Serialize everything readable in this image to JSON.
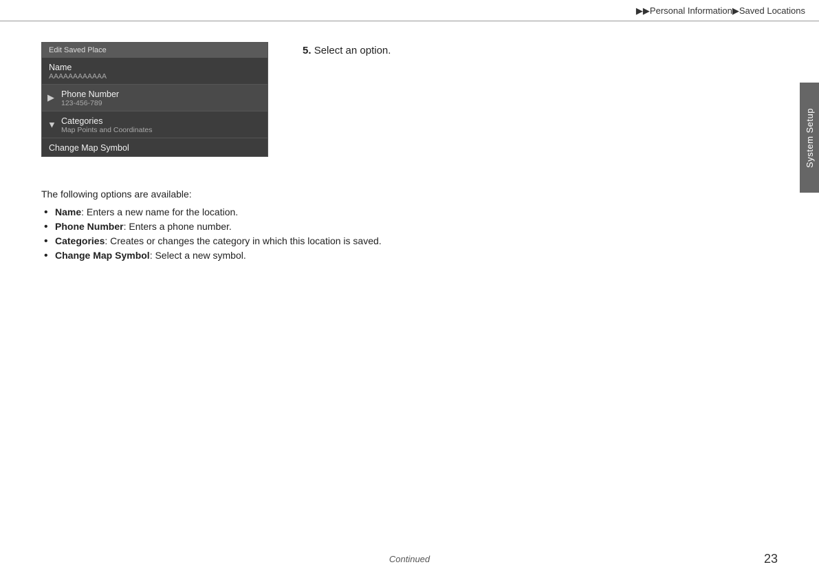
{
  "header": {
    "breadcrumb_arrow1": "▶▶",
    "breadcrumb_part1": "Personal Information",
    "breadcrumb_arrow2": "▶",
    "breadcrumb_part2": "Saved Locations"
  },
  "sidebar": {
    "label": "System Setup"
  },
  "screen": {
    "title": "Edit Saved Place",
    "items": [
      {
        "label": "Name",
        "sub": "AAAAAAAAAAAA",
        "has_left_arrow": false,
        "has_down_arrow": false
      },
      {
        "label": "Phone Number",
        "sub": "123-456-789",
        "has_left_arrow": true,
        "has_down_arrow": false
      },
      {
        "label": "Categories",
        "sub": "Map Points and Coordinates",
        "has_left_arrow": false,
        "has_down_arrow": true
      },
      {
        "label": "Change Map Symbol",
        "sub": "",
        "has_left_arrow": false,
        "has_down_arrow": false
      }
    ]
  },
  "step": {
    "number": "5.",
    "text": "Select an option."
  },
  "body": {
    "intro": "The following options are available:",
    "bullets": [
      {
        "term": "Name",
        "description": ": Enters a new name for the location."
      },
      {
        "term": "Phone Number",
        "description": ": Enters a phone number."
      },
      {
        "term": "Categories",
        "description": ": Creates or changes the category in which this location is saved."
      },
      {
        "term": "Change Map Symbol",
        "description": ": Select a new symbol."
      }
    ]
  },
  "footer": {
    "continued": "Continued",
    "page": "23"
  }
}
